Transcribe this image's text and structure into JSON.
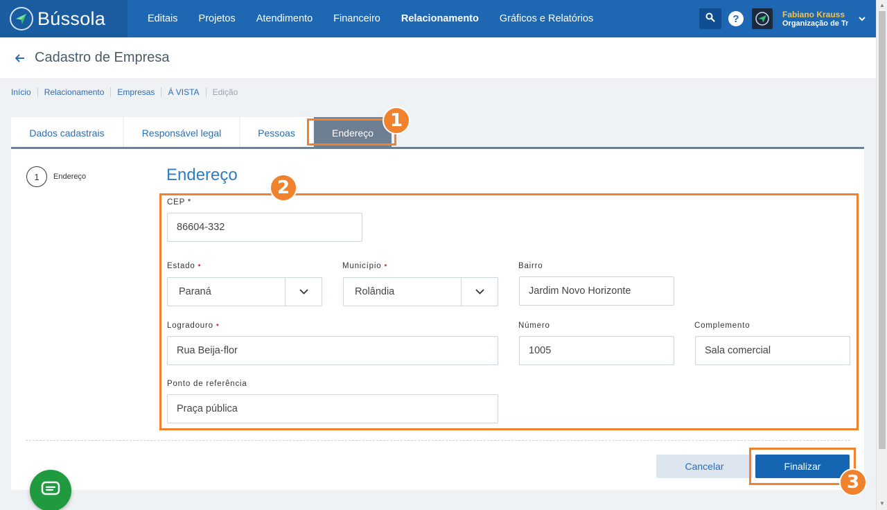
{
  "app": {
    "name": "Bússola"
  },
  "nav": {
    "items": [
      {
        "label": "Editais"
      },
      {
        "label": "Projetos"
      },
      {
        "label": "Atendimento"
      },
      {
        "label": "Financeiro"
      },
      {
        "label": "Relacionamento"
      },
      {
        "label": "Gráficos e Relatórios"
      }
    ],
    "active": "Relacionamento"
  },
  "user": {
    "name": "Fabiano Krauss",
    "org": "Organização de Tre"
  },
  "page": {
    "title": "Cadastro de Empresa"
  },
  "breadcrumb": [
    "Início",
    "Relacionamento",
    "Empresas",
    "Á VISTA",
    "Edição"
  ],
  "tabs": [
    {
      "label": "Dados cadastrais"
    },
    {
      "label": "Responsável legal"
    },
    {
      "label": "Pessoas"
    },
    {
      "label": "Endereço"
    }
  ],
  "active_tab": "Endereço",
  "steps": [
    {
      "number": "1",
      "label": "Endereço"
    }
  ],
  "section": {
    "title": "Endereço"
  },
  "form": {
    "cep": {
      "label": "CEP",
      "required_mark": "*",
      "value": "86604-332"
    },
    "estado": {
      "label": "Estado",
      "required_mark": "•",
      "value": "Paraná"
    },
    "municipio": {
      "label": "Município",
      "required_mark": "•",
      "value": "Rolândia"
    },
    "bairro": {
      "label": "Bairro",
      "value": "Jardim Novo Horizonte"
    },
    "logradouro": {
      "label": "Logradouro",
      "required_mark": "•",
      "value": "Rua Beija-flor"
    },
    "numero": {
      "label": "Número",
      "value": "1005"
    },
    "complemento": {
      "label": "Complemento",
      "value": "Sala comercial"
    },
    "referencia": {
      "label": "Ponto de referência",
      "value": "Praça pública"
    }
  },
  "buttons": {
    "cancel": "Cancelar",
    "finish": "Finalizar"
  },
  "annotations": [
    "1",
    "2",
    "3"
  ],
  "colors": {
    "nav_bg": "#1d67b3",
    "accent_orange": "#f0822d",
    "primary_button": "#1565b2",
    "tab_active": "#6e7f94",
    "chat_green": "#1f9a3f",
    "user_name": "#f6c343"
  },
  "icons": {
    "logo": "compass-icon",
    "search": "search-icon",
    "help": "help-icon",
    "back": "arrow-left-icon",
    "select": "chevron-down-icon",
    "chat": "chat-icon"
  }
}
